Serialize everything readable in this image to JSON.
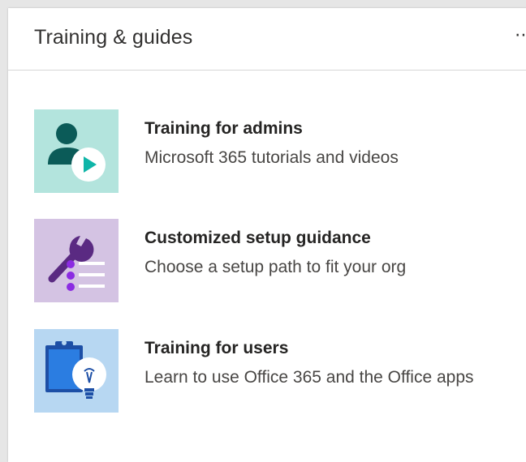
{
  "card": {
    "title": "Training & guides",
    "more_label": "⋯"
  },
  "items": [
    {
      "title": "Training for admins",
      "description": "Microsoft 365 tutorials and videos",
      "icon": "admin-video-icon",
      "tile_color": "#b3e4dd"
    },
    {
      "title": "Customized setup guidance",
      "description": "Choose a setup path to fit your org",
      "icon": "wrench-list-icon",
      "tile_color": "#d4c3e3"
    },
    {
      "title": "Training for users",
      "description": "Learn to use Office 365 and the Office apps",
      "icon": "clipboard-lightbulb-icon",
      "tile_color": "#b7d7f2"
    }
  ]
}
